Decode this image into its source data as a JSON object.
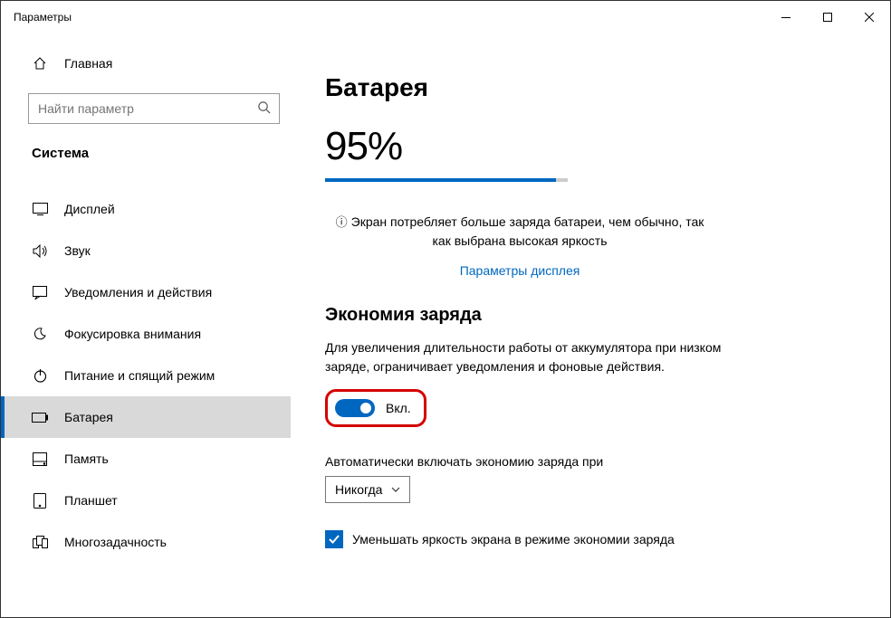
{
  "window": {
    "title": "Параметры"
  },
  "sidebar": {
    "home": "Главная",
    "search_placeholder": "Найти параметр",
    "category": "Система",
    "items": [
      {
        "label": "Дисплей"
      },
      {
        "label": "Звук"
      },
      {
        "label": "Уведомления и действия"
      },
      {
        "label": "Фокусировка внимания"
      },
      {
        "label": "Питание и спящий режим"
      },
      {
        "label": "Батарея"
      },
      {
        "label": "Память"
      },
      {
        "label": "Планшет"
      },
      {
        "label": "Многозадачность"
      }
    ]
  },
  "main": {
    "title": "Батарея",
    "percent_text": "95%",
    "percent_value": 95,
    "info": "Экран потребляет больше заряда батареи, чем обычно, так как выбрана высокая яркость",
    "link": "Параметры дисплея",
    "section": "Экономия заряда",
    "desc": "Для увеличения длительности работы от аккумулятора при низком заряде, ограничивает уведомления и фоновые действия.",
    "toggle_label": "Вкл.",
    "auto_label": "Автоматически включать экономию заряда при",
    "auto_value": "Никогда",
    "checkbox_label": "Уменьшать яркость экрана в режиме экономии заряда"
  }
}
